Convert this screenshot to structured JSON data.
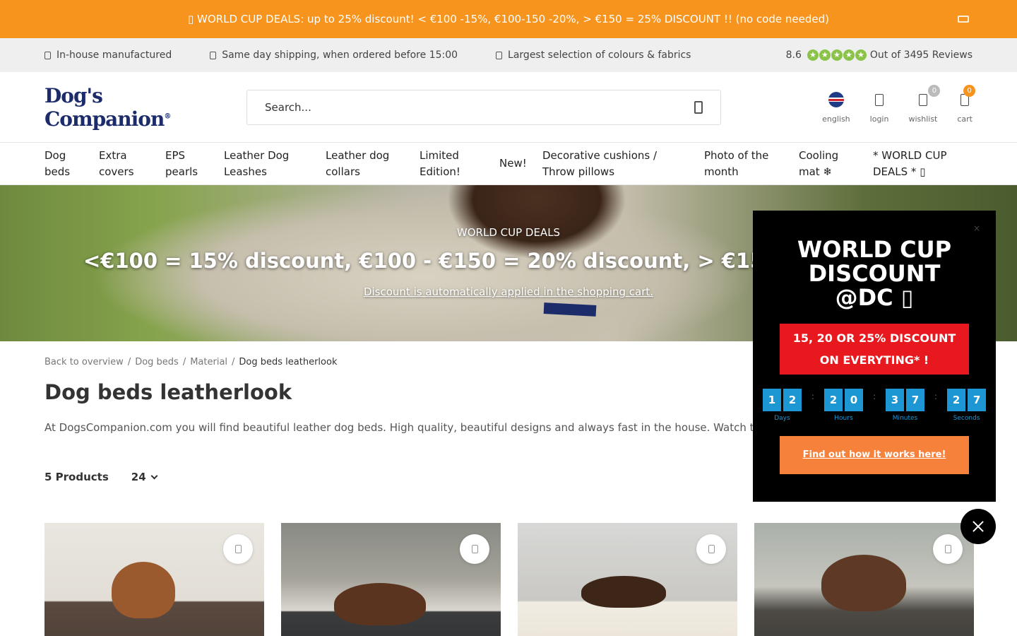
{
  "promo": {
    "text": "▯ WORLD CUP DEALS: up to 25% discount! < €100 -15%, €100-150 -20%, > €150 = 25% DISCOUNT !! (no code needed)"
  },
  "usps": [
    {
      "icon": "factory-icon",
      "label": "In-house manufactured"
    },
    {
      "icon": "truck-icon",
      "label": "Same day shipping, when ordered before 15:00"
    },
    {
      "icon": "palette-icon",
      "label": "Largest selection of colours & fabrics"
    }
  ],
  "reviews": {
    "score": "8.6",
    "label": "Out of 3495 Reviews",
    "star_color": "#8bc34a",
    "stars": 5
  },
  "header": {
    "logo": "Dog's Companion",
    "logo_mark": "®",
    "search_placeholder": "Search...",
    "actions": [
      {
        "icon": "uk-flag-icon",
        "label": "english"
      },
      {
        "icon": "user-icon",
        "label": "login"
      },
      {
        "icon": "heart-icon",
        "label": "wishlist",
        "count": "0"
      },
      {
        "icon": "cart-icon",
        "label": "cart",
        "count": "0"
      }
    ]
  },
  "nav": [
    {
      "label": "Dog beds",
      "lines": [
        "Dog",
        "beds"
      ]
    },
    {
      "label": "Extra covers",
      "lines": [
        "Extra",
        "covers"
      ]
    },
    {
      "label": "EPS pearls",
      "lines": [
        "EPS",
        "pearls"
      ]
    },
    {
      "label": "Leather Dog Leashes",
      "lines": [
        "Leather Dog",
        "Leashes"
      ]
    },
    {
      "label": "Leather dog collars",
      "lines": [
        "Leather dog",
        "collars"
      ]
    },
    {
      "label": "Limited Edition!",
      "lines": [
        "Limited",
        "Edition!"
      ]
    },
    {
      "label": "New!",
      "lines": [
        "New!"
      ]
    },
    {
      "label": "Decorative cushions / Throw pillows",
      "lines": [
        "Decorative cushions /",
        "Throw pillows"
      ]
    },
    {
      "label": "Photo of the month",
      "lines": [
        "Photo of the",
        "month"
      ]
    },
    {
      "label": "Cooling mat ❄",
      "lines": [
        "Cooling",
        "mat ❄"
      ]
    },
    {
      "label": "* WORLD CUP DEALS * ▯",
      "lines": [
        "* WORLD CUP",
        "DEALS * ▯"
      ]
    }
  ],
  "hero": {
    "subtitle": "WORLD CUP DEALS",
    "title": "<€100 = 15% discount, €100 - €150 = 20% discount, > €150",
    "link": "Discount is automatically applied in the shopping cart."
  },
  "breadcrumb": [
    "Back to overview",
    "Dog beds",
    "Material",
    "Dog beds leatherlook"
  ],
  "page": {
    "title": "Dog beds leatherlook",
    "intro": "At DogsCompanion.com you will find beautiful leather dog beds. High quality, beautiful designs and always fast in the house. Watch t",
    "product_count": "5 Products",
    "per_page": "24"
  },
  "products": [
    {
      "name": "product-1",
      "wishlist_icon": "heart-icon"
    },
    {
      "name": "product-2",
      "wishlist_icon": "heart-icon"
    },
    {
      "name": "product-3",
      "wishlist_icon": "heart-icon"
    },
    {
      "name": "product-4",
      "wishlist_icon": "heart-icon"
    }
  ],
  "popup": {
    "close_label": "×",
    "title_lines": [
      "WORLD CUP",
      "DISCOUNT",
      "@DC ▯"
    ],
    "offer_lines": [
      "15, 20 OR 25% DISCOUNT",
      "ON EVERYTING* !"
    ],
    "timer": [
      {
        "digits": [
          "1",
          "2"
        ],
        "label": "Days"
      },
      {
        "digits": [
          "2",
          "0"
        ],
        "label": "Hours"
      },
      {
        "digits": [
          "3",
          "7"
        ],
        "label": "Minutes"
      },
      {
        "digits": [
          "2",
          "7"
        ],
        "label": "Seconds"
      }
    ],
    "separator": ":",
    "cta": "Find out how it works here!"
  },
  "colors": {
    "accent": "#f7941d",
    "brand": "#1c2c6b",
    "popup_red": "#e8191e",
    "timer_blue": "#1d96d4",
    "cta_orange": "#f5813b"
  }
}
